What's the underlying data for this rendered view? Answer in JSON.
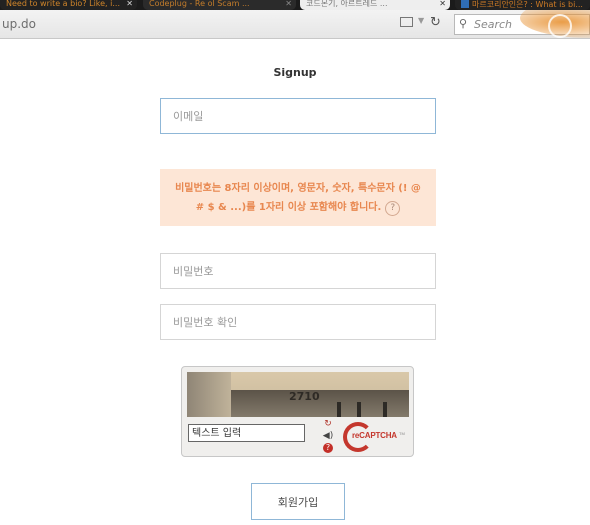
{
  "browser": {
    "tabs": [
      {
        "title": "Need to write a bio? Like, i..."
      },
      {
        "title": "Codeplug - Re ol Scam ..."
      },
      {
        "title": "코드몬기, 아르트레드 ..."
      },
      {
        "title": "마르코리안인은? : What is bi..."
      }
    ],
    "tab_close_glyph": "✕",
    "url": "up.do",
    "search_placeholder": "Search",
    "icons": [
      "reader-view-icon",
      "dropdown-icon",
      "reload-icon",
      "search-icon"
    ]
  },
  "page": {
    "title": "Signup",
    "email_placeholder": "이메일",
    "notice_line1": "비밀번호는 8자리 이상이며, 영문자, 숫자, 특수문자 (! @",
    "notice_line2": "# $ & ...)를 1자리 이상 포함해야 합니다.",
    "notice_help_glyph": "?",
    "password_placeholder": "비밀번호",
    "password_confirm_placeholder": "비밀번호 확인",
    "submit_label": "회원가입"
  },
  "captcha": {
    "image_text": "2710",
    "input_placeholder": "텍스트 입력",
    "brand": "reCAPTCHA",
    "tm": "TM",
    "icons": [
      "refresh-icon",
      "audio-icon",
      "help-icon"
    ]
  },
  "colors": {
    "notice_bg": "#fde6d6",
    "notice_text": "#e8874f",
    "focus_border": "#8fb7d7",
    "recaptcha_red": "#c4372d"
  }
}
